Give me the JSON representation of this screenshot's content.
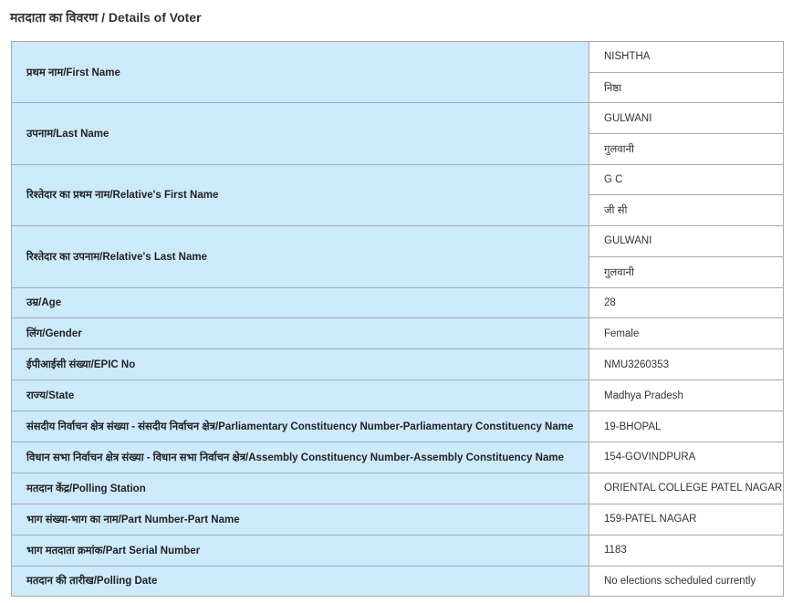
{
  "title": "मतदाता का विवरण / Details of Voter",
  "double_rows": [
    {
      "label": "प्रथम नाम/First Name",
      "values": [
        "NISHTHA",
        "निष्ठा"
      ]
    },
    {
      "label": "उपनाम/Last Name",
      "values": [
        "GULWANI",
        "गुलवानी"
      ]
    },
    {
      "label": "रिश्तेदार का प्रथम नाम/Relative's First Name",
      "values": [
        "G C",
        "जी सी"
      ]
    },
    {
      "label": "रिश्तेदार का उपनाम/Relative's Last Name",
      "values": [
        "GULWANI",
        "गुलवानी"
      ]
    }
  ],
  "single_rows": [
    {
      "label": "उम्र/Age",
      "value": "28"
    },
    {
      "label": "लिंग/Gender",
      "value": "Female"
    },
    {
      "label": "ईपीआईसी संख्या/EPIC No",
      "value": "NMU3260353"
    },
    {
      "label": "राज्य/State",
      "value": "Madhya Pradesh"
    },
    {
      "label": "संसदीय निर्वाचन क्षेत्र संख्या - संसदीय निर्वाचन क्षेत्र/Parliamentary Constituency Number-Parliamentary Constituency Name",
      "value": "19-BHOPAL"
    },
    {
      "label": "विधान सभा निर्वाचन क्षेत्र संख्या - विधान सभा निर्वाचन क्षेत्र/Assembly Constituency Number-Assembly Constituency Name",
      "value": "154-GOVINDPURA"
    },
    {
      "label": "मतदान केंद्र/Polling Station",
      "value": "ORIENTAL COLLEGE PATEL NAGAR"
    },
    {
      "label": "भाग संख्या-भाग का नाम/Part Number-Part Name",
      "value": "159-PATEL NAGAR"
    },
    {
      "label": "भाग मतदाता क्रमांक/Part Serial Number",
      "value": "1183"
    },
    {
      "label": "मतदान की तारीख/Polling Date",
      "value": "No elections scheduled currently"
    }
  ]
}
